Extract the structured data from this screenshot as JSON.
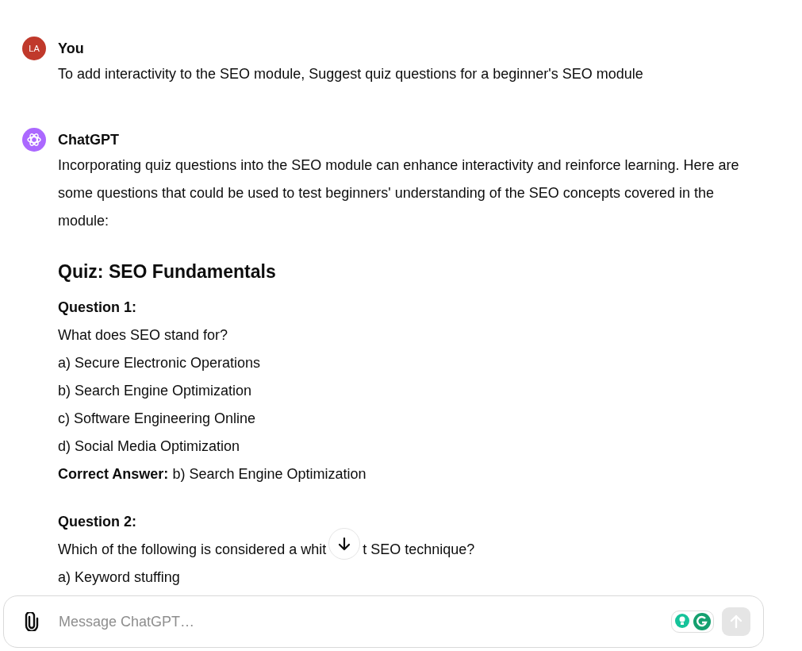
{
  "messages": [
    {
      "author": "You",
      "avatar": {
        "kind": "initials",
        "text": "LA",
        "color": "#c0392b"
      },
      "blocks": [
        {
          "kind": "paragraph",
          "text": "To add interactivity to the SEO module, Suggest quiz questions for a beginner's SEO module"
        }
      ]
    },
    {
      "author": "ChatGPT",
      "avatar": {
        "kind": "logo",
        "color": "#ab68ff"
      },
      "blocks": [
        {
          "kind": "paragraph",
          "text": "Incorporating quiz questions into the SEO module can enhance interactivity and reinforce learning. Here are some questions that could be used to test beginners' understanding of the SEO concepts covered in the module:"
        },
        {
          "kind": "heading",
          "text": "Quiz: SEO Fundamentals"
        },
        {
          "kind": "label",
          "text": "Question 1:"
        },
        {
          "kind": "line",
          "text": "What does SEO stand for?"
        },
        {
          "kind": "line",
          "text": "a) Secure Electronic Operations"
        },
        {
          "kind": "line",
          "text": "b) Search Engine Optimization"
        },
        {
          "kind": "line",
          "text": "c) Software Engineering Online"
        },
        {
          "kind": "line",
          "text": "d) Social Media Optimization"
        },
        {
          "kind": "line",
          "text": "**Correct Answer:** b) Search Engine Optimization"
        },
        {
          "kind": "label",
          "text": "Question 2:",
          "spaced": true
        },
        {
          "kind": "split",
          "parts": [
            "Which of the following is considered a whit",
            "t SEO technique?"
          ]
        },
        {
          "kind": "line",
          "text": "a) Keyword stuffing"
        }
      ]
    }
  ],
  "composer": {
    "placeholder": "Message ChatGPT…"
  }
}
